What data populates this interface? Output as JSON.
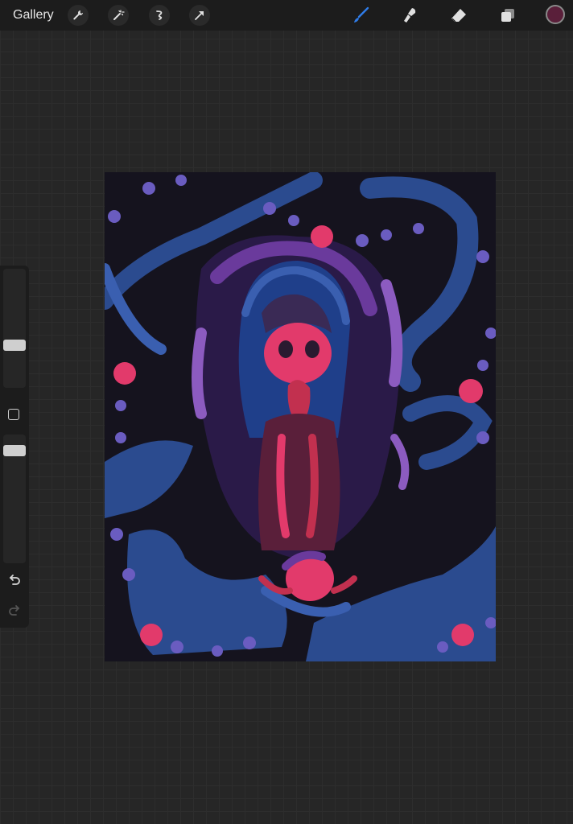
{
  "topbar": {
    "gallery_label": "Gallery",
    "left_tools": [
      "wrench-icon",
      "magic-wand-icon",
      "selection-icon",
      "transform-arrow-icon"
    ],
    "right_tools": [
      "brush-icon",
      "smudge-icon",
      "eraser-icon",
      "layers-icon"
    ],
    "active_tool": "brush-icon",
    "current_color": "#5a1f3a"
  },
  "sidebar": {
    "brush_size_slider": "brush-size",
    "opacity_slider": "opacity",
    "icons": [
      "modify-square-icon",
      "undo-icon",
      "redo-icon"
    ]
  },
  "canvas": {
    "artwork": "painted-illustration",
    "palette": [
      "#15131e",
      "#2b4b8f",
      "#3a5fb0",
      "#6a3a9c",
      "#8c5bc0",
      "#e23a6b",
      "#c2304f"
    ]
  }
}
